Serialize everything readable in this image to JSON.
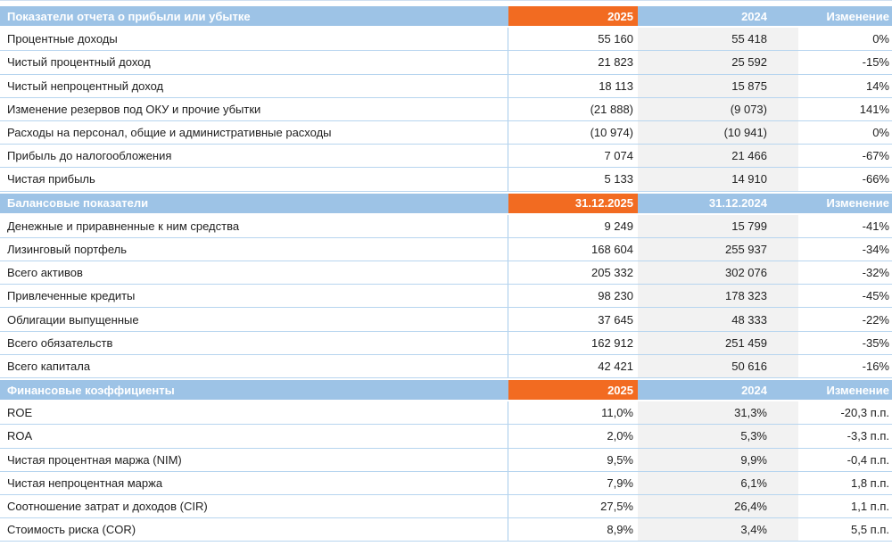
{
  "colors": {
    "section_blue": "#9DC3E6",
    "accent_orange": "#F26B21",
    "row_line": "#B7D5EF",
    "column_line": "#A6CBEB",
    "gray_band": "#F2F2F2",
    "header_text": "#FFFFFF",
    "body_text": "#212121"
  },
  "table": {
    "sections": [
      {
        "header": {
          "label": "Показатели отчета о прибыли или убытке",
          "col_2025": "2025",
          "col_2024": "2024",
          "col_change": "Изменение"
        },
        "rows": [
          {
            "label": "Процентные доходы",
            "v2025": "55 160",
            "v2024": "55 418",
            "change": "0%"
          },
          {
            "label": "Чистый процентный доход",
            "v2025": "21 823",
            "v2024": "25 592",
            "change": "-15%"
          },
          {
            "label": "Чистый непроцентный доход",
            "v2025": "18 113",
            "v2024": "15 875",
            "change": "14%"
          },
          {
            "label": "Изменение резервов под ОКУ и прочие убытки",
            "v2025": "(21 888)",
            "v2024": "(9 073)",
            "change": "141%"
          },
          {
            "label": "Расходы на персонал, общие и административные расходы",
            "v2025": "(10 974)",
            "v2024": "(10 941)",
            "change": "0%"
          },
          {
            "label": "Прибыль до налогообложения",
            "v2025": "7 074",
            "v2024": "21 466",
            "change": "-67%"
          },
          {
            "label": "Чистая прибыль",
            "v2025": "5 133",
            "v2024": "14 910",
            "change": "-66%"
          }
        ]
      },
      {
        "header": {
          "label": "Балансовые показатели",
          "col_2025": "31.12.2025",
          "col_2024": "31.12.2024",
          "col_change": "Изменение"
        },
        "rows": [
          {
            "label": "Денежные и приравненные к ним средства",
            "v2025": "9 249",
            "v2024": "15 799",
            "change": "-41%"
          },
          {
            "label": "Лизинговый портфель",
            "v2025": "168 604",
            "v2024": "255 937",
            "change": "-34%"
          },
          {
            "label": "Всего активов",
            "v2025": "205 332",
            "v2024": "302 076",
            "change": "-32%"
          },
          {
            "label": "Привлеченные кредиты",
            "v2025": "98 230",
            "v2024": "178 323",
            "change": "-45%"
          },
          {
            "label": "Облигации выпущенные",
            "v2025": "37 645",
            "v2024": "48 333",
            "change": "-22%"
          },
          {
            "label": "Всего обязательств",
            "v2025": "162 912",
            "v2024": "251 459",
            "change": "-35%"
          },
          {
            "label": "Всего капитала",
            "v2025": "42 421",
            "v2024": "50 616",
            "change": "-16%"
          }
        ]
      },
      {
        "header": {
          "label": "Финансовые коэффициенты",
          "col_2025": "2025",
          "col_2024": "2024",
          "col_change": "Изменение"
        },
        "rows": [
          {
            "label": "ROE",
            "v2025": "11,0%",
            "v2024": "31,3%",
            "change": "-20,3 п.п."
          },
          {
            "label": "ROA",
            "v2025": "2,0%",
            "v2024": "5,3%",
            "change": "-3,3 п.п."
          },
          {
            "label": "Чистая процентная маржа (NIM)",
            "v2025": "9,5%",
            "v2024": "9,9%",
            "change": "-0,4 п.п."
          },
          {
            "label": "Чистая непроцентная маржа",
            "v2025": "7,9%",
            "v2024": "6,1%",
            "change": "1,8 п.п."
          },
          {
            "label": "Соотношение затрат и доходов (CIR)",
            "v2025": "27,5%",
            "v2024": "26,4%",
            "change": "1,1 п.п."
          },
          {
            "label": "Стоимость риска (COR)",
            "v2025": "8,9%",
            "v2024": "3,4%",
            "change": "5,5 п.п."
          }
        ]
      }
    ]
  }
}
